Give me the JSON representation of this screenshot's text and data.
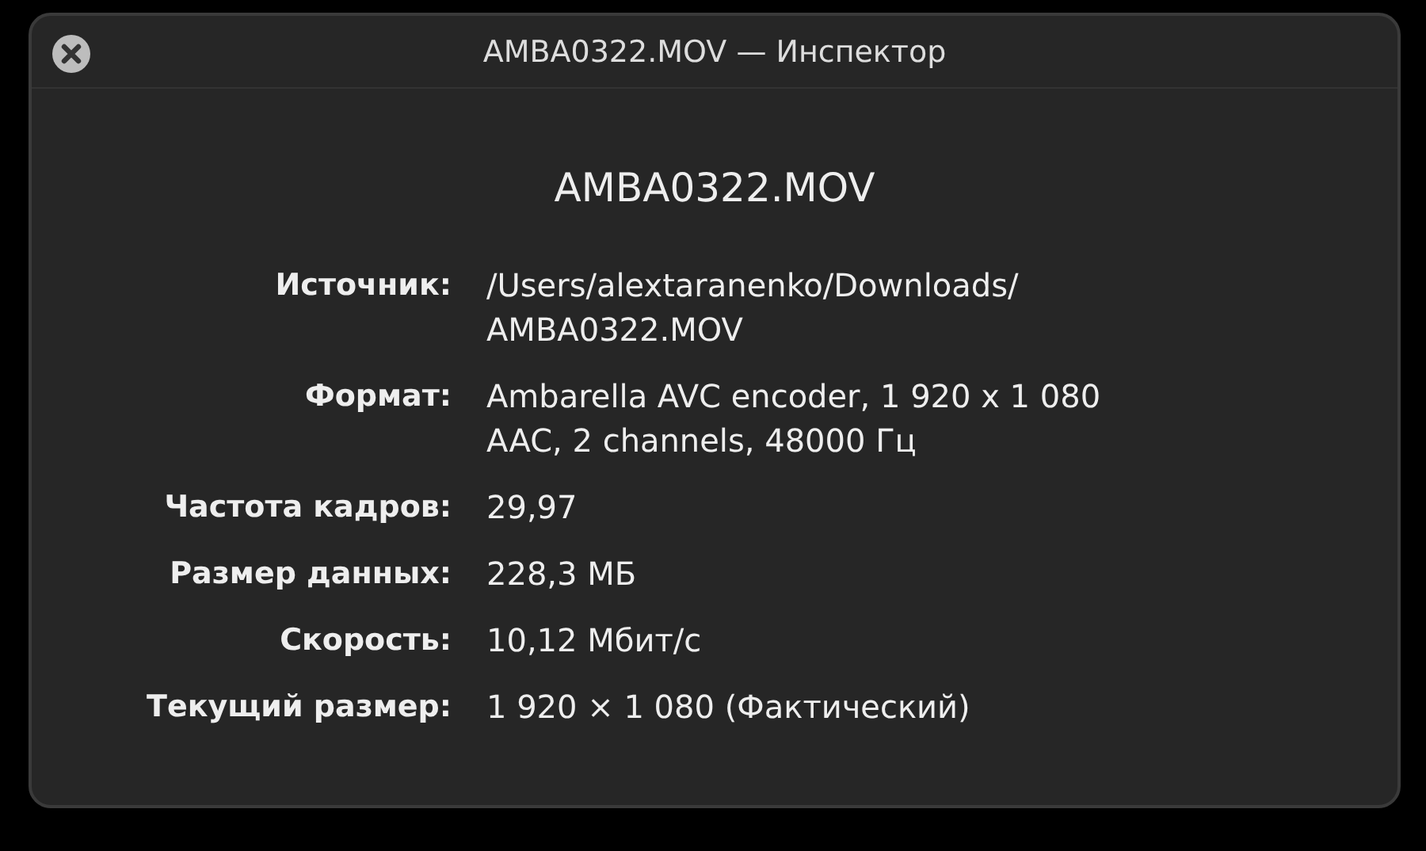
{
  "window": {
    "title": "AMBA0322.MOV — Инспектор"
  },
  "heading": "AMBA0322.MOV",
  "properties": [
    {
      "label": "Источник:",
      "lines": [
        "/Users/alextaranenko/Downloads/",
        "AMBA0322.MOV"
      ]
    },
    {
      "label": "Формат:",
      "lines": [
        "Ambarella AVC encoder, 1 920 x 1 080",
        "AAC, 2 channels, 48000 Гц"
      ]
    },
    {
      "label": "Частота кадров:",
      "lines": [
        "29,97"
      ]
    },
    {
      "label": "Размер данных:",
      "lines": [
        "228,3 МБ"
      ]
    },
    {
      "label": "Скорость:",
      "lines": [
        "10,12 Мбит/с"
      ]
    },
    {
      "label": "Текущий размер:",
      "lines": [
        "1 920 × 1 080 (Фактический)"
      ]
    }
  ]
}
